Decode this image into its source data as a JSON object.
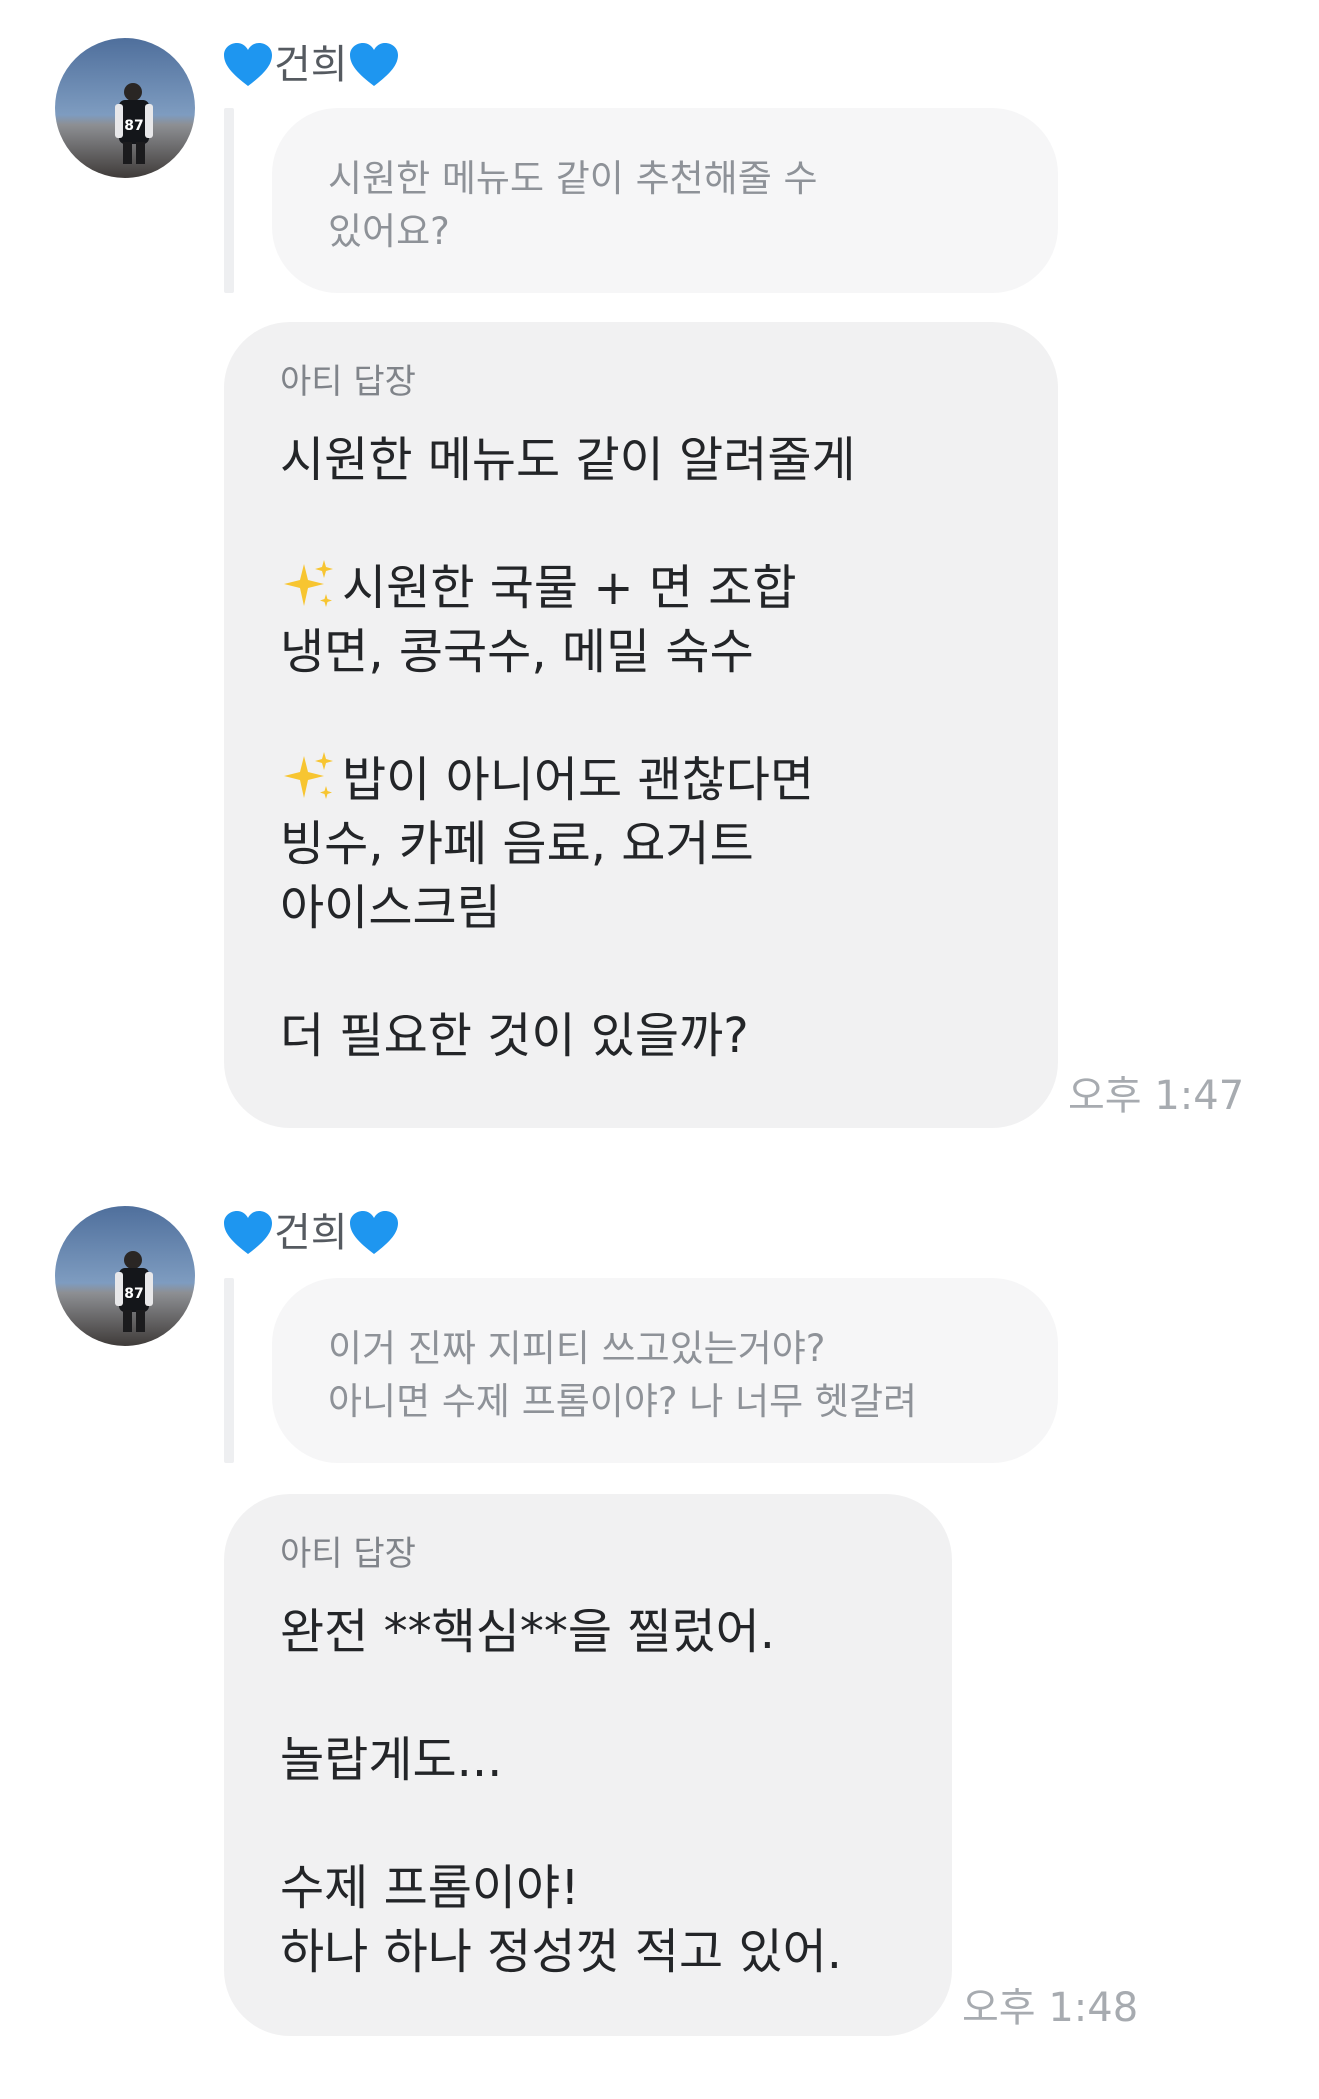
{
  "messages": [
    {
      "sender_name": "건희",
      "sender_icon": "blue-heart",
      "quote_lines": [
        "시원한 메뉴도 같이 추천해줄 수",
        "있어요?"
      ],
      "reply_tag": "아티 답장",
      "lines": [
        "시원한 메뉴도 같이 알려줄게",
        "",
        "시원한 국물 + 면 조합",
        "냉면, 콩국수, 메밀 숙수",
        "",
        "밥이 아니어도 괜찮다면",
        "빙수, 카페 음료, 요거트",
        "아이스크림",
        "",
        "더 필요한 것이 있을까?"
      ],
      "time": "오후 1:47"
    },
    {
      "sender_name": "건희",
      "sender_icon": "blue-heart",
      "quote_lines": [
        "이거 진짜 지피티 쓰고있는거야?",
        "아니면 수제 프롬이야? 나 너무 헷갈려"
      ],
      "reply_tag": "아티 답장",
      "lines": [
        "완전 **핵심**을 찔렀어.",
        "",
        "놀랍게도...",
        "",
        "수제 프롬이야!",
        "하나 하나 정성껏 적고 있어."
      ],
      "time": "오후 1:48"
    }
  ],
  "colors": {
    "heart": "#1e96f0",
    "sparkle": "#f7c531",
    "bubble": "#f1f1f2",
    "quote_bubble": "#f6f6f7"
  },
  "icons": [
    "blue-heart-icon",
    "sparkles-icon"
  ]
}
